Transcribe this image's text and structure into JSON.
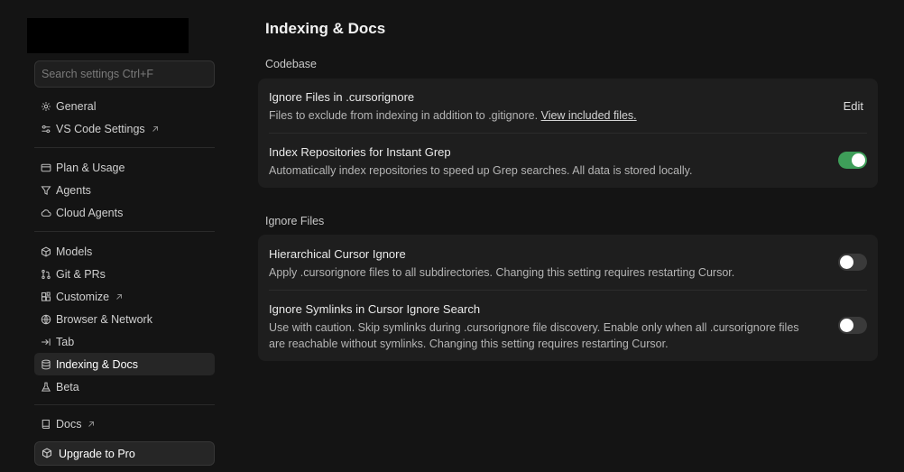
{
  "sidebar": {
    "search_placeholder": "Search settings Ctrl+F",
    "groups": [
      [
        {
          "label": "General",
          "icon": "gear-icon"
        },
        {
          "label": "VS Code Settings",
          "icon": "sliders-icon",
          "external": true
        }
      ],
      [
        {
          "label": "Plan & Usage",
          "icon": "card-icon"
        },
        {
          "label": "Agents",
          "icon": "funnel-icon"
        },
        {
          "label": "Cloud Agents",
          "icon": "cloud-icon"
        }
      ],
      [
        {
          "label": "Models",
          "icon": "cube-icon"
        },
        {
          "label": "Git & PRs",
          "icon": "git-icon"
        },
        {
          "label": "Customize",
          "icon": "blocks-icon",
          "external": true
        },
        {
          "label": "Browser & Network",
          "icon": "globe-icon"
        },
        {
          "label": "Tab",
          "icon": "tab-arrow-icon"
        },
        {
          "label": "Indexing & Docs",
          "icon": "database-icon",
          "active": true
        },
        {
          "label": "Beta",
          "icon": "flask-icon"
        }
      ],
      [
        {
          "label": "Docs",
          "icon": "book-icon",
          "external": true
        }
      ]
    ],
    "upgrade_label": "Upgrade to Pro"
  },
  "main": {
    "title": "Indexing & Docs",
    "sections": [
      {
        "label": "Codebase",
        "rows": [
          {
            "title": "Ignore Files in .cursorignore",
            "desc": "Files to exclude from indexing in addition to .gitignore.",
            "link": "View included files.",
            "control": "edit",
            "control_label": "Edit"
          },
          {
            "title": "Index Repositories for Instant Grep",
            "desc": "Automatically index repositories to speed up Grep searches. All data is stored locally.",
            "control": "toggle",
            "on": true
          }
        ]
      },
      {
        "label": "Ignore Files",
        "rows": [
          {
            "title": "Hierarchical Cursor Ignore",
            "desc": "Apply .cursorignore files to all subdirectories. Changing this setting requires restarting Cursor.",
            "control": "toggle",
            "on": false
          },
          {
            "title": "Ignore Symlinks in Cursor Ignore Search",
            "desc_line1": "Use with caution. Skip symlinks during .cursorignore file discovery. Enable only when all .cursorignore files",
            "desc_line2": "are reachable without symlinks. Changing this setting requires restarting Cursor.",
            "control": "toggle",
            "on": false
          }
        ]
      }
    ]
  },
  "colors": {
    "background": "#141414",
    "card": "#1e1e1e",
    "toggle_on": "#3e9e59",
    "toggle_off": "#3a3a3a"
  }
}
